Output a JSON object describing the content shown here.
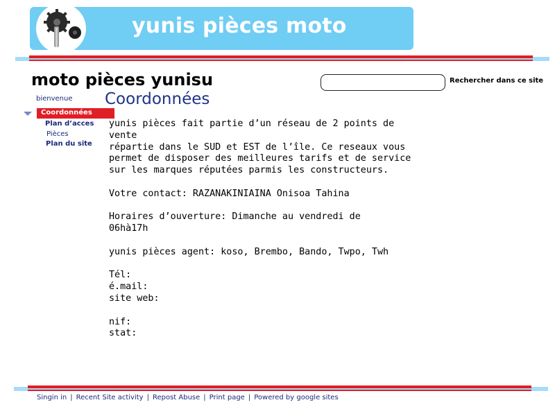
{
  "header": {
    "site_title": "yunis pièces moto",
    "logo_icon": "gear-shaft-icon"
  },
  "page": {
    "heading": "moto pièces yunisu",
    "section_title": "Coordonnées"
  },
  "search": {
    "placeholder": "",
    "button_label": "Rechercher dans ce site"
  },
  "nav": {
    "items": [
      {
        "label": "bienvenue"
      },
      {
        "label": "Coordonnées",
        "active": true
      },
      {
        "label": "Plan d’acces"
      },
      {
        "label": "Pièces"
      },
      {
        "label": "Plan du site"
      }
    ]
  },
  "content": {
    "intro": "yunis pièces fait partie d’un réseau de 2 points de vente\nrépartie dans le SUD et EST de l’île. Ce reseaux vous\npermet de disposer des meilleures tarifs et de service\nsur les marques réputées parmis les constructeurs.",
    "contact": "Votre contact: RAZANAKINIAINA Onisoa Tahina",
    "hours": "Horaires d’ouverture: Dimanche au vendredi de\n06hà17h",
    "agent": "yunis pièces agent: koso, Brembo, Bando, Twpo, Twh",
    "contact_fields": "Tél:\né.mail:\nsite web:",
    "legal_fields": "nif:\nstat:"
  },
  "footer": {
    "links": [
      "Singin in",
      "Recent Site activity",
      "Repost Abuse",
      "Print page",
      "Powered by google sites"
    ]
  },
  "colors": {
    "banner": "#70cdf4",
    "accent_red": "#e01e26",
    "nav_text": "#1a2a7a",
    "section_title": "#1f3486"
  }
}
